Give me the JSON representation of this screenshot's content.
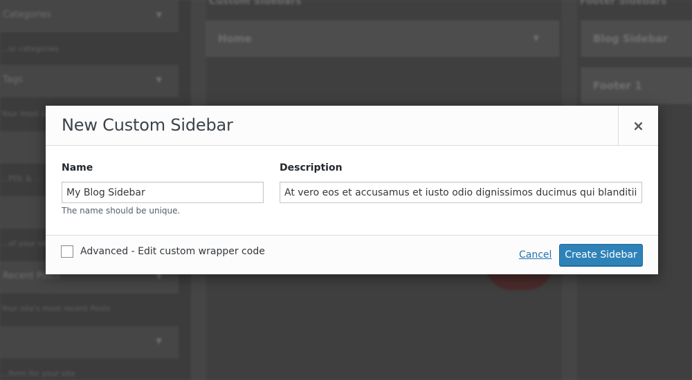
{
  "background": {
    "sidebar_rows": [
      {
        "label": "Categories",
        "desc": "...or categories"
      },
      {
        "label": "Tags",
        "desc": "Your most used tags"
      },
      {
        "label": "",
        "desc": "...PDL & ..."
      },
      {
        "label": "",
        "desc": "...of your site"
      },
      {
        "label": "Recent Posts",
        "desc": "Your site's most recent Posts"
      },
      {
        "label": "",
        "desc": "...form for your site"
      }
    ],
    "col1_header": "Custom Sidebars",
    "col1_box": "Home",
    "col2_header": "Footer Sidebars",
    "col2_boxes": [
      "Blog Sidebar",
      "Footer 1"
    ]
  },
  "modal": {
    "title": "New Custom Sidebar",
    "close_symbol": "×",
    "name_label": "Name",
    "name_value": "My Blog Sidebar",
    "name_hint": "The name should be unique.",
    "description_label": "Description",
    "description_value": "At vero eos et accusamus et iusto odio dignissimos ducimus qui blanditiis",
    "advanced_label": "Advanced - Edit custom wrapper code",
    "advanced_checked": false,
    "cancel_label": "Cancel",
    "create_label": "Create Sidebar"
  },
  "colors": {
    "overlay_bg": "#4a4a4a",
    "primary_button": "#2e82b8",
    "link": "#2271b1"
  }
}
